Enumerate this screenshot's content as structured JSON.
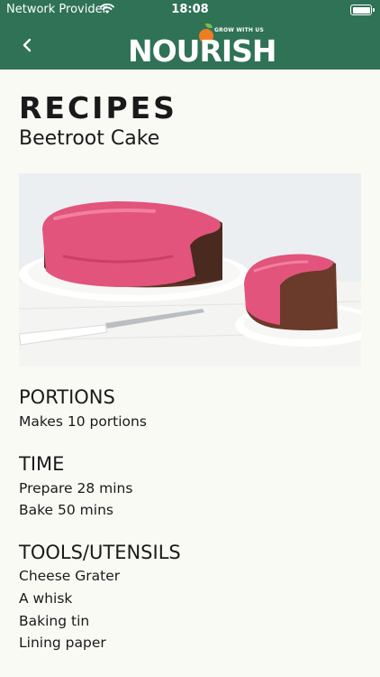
{
  "status_bar": {
    "carrier": "Network Provider",
    "time": "18:08"
  },
  "header": {
    "logo_text": "NOURISH",
    "logo_tagline": "GROW WITH US"
  },
  "page": {
    "heading": "RECIPES",
    "recipe_name": "Beetroot Cake"
  },
  "sections": {
    "portions": {
      "title": "PORTIONS",
      "lines": [
        "Makes 10 portions"
      ]
    },
    "time": {
      "title": "TIME",
      "lines": [
        "Prepare 28 mins",
        "Bake 50 mins"
      ]
    },
    "tools": {
      "title": "TOOLS/UTENSILS",
      "lines": [
        "Cheese Grater",
        "A whisk",
        "Baking tin",
        "Lining paper"
      ]
    }
  },
  "colors": {
    "header_bg": "#2f7256",
    "page_bg": "#fafaf5",
    "frosting": "#e2547c",
    "logo_orange": "#f07c24"
  }
}
